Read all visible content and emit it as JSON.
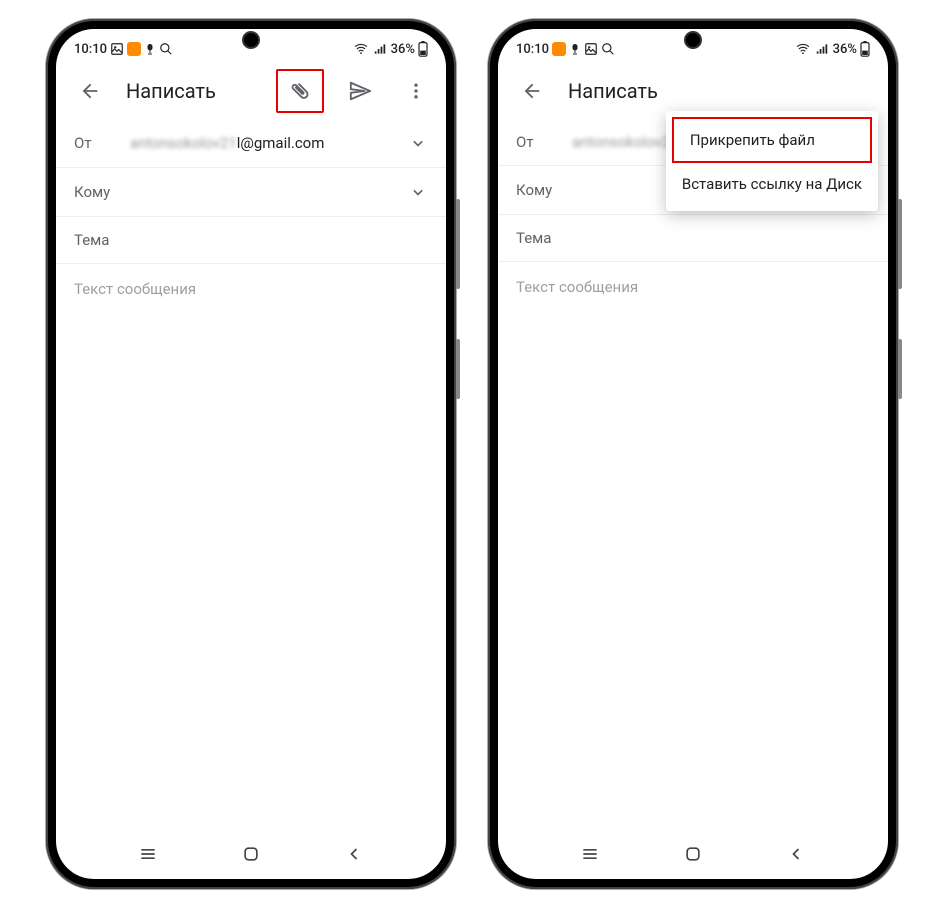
{
  "status": {
    "time": "10:10",
    "battery_text": "36%"
  },
  "compose": {
    "title": "Написать",
    "from_label": "От",
    "from_value_hidden": "antonsokolov21",
    "from_value_visible": "l@gmail.com",
    "to_label": "Кому",
    "subject_label": "Тема",
    "body_placeholder": "Текст сообщения"
  },
  "menu": {
    "attach_file": "Прикрепить файл",
    "insert_drive_link": "Вставить ссылку на Диск"
  }
}
